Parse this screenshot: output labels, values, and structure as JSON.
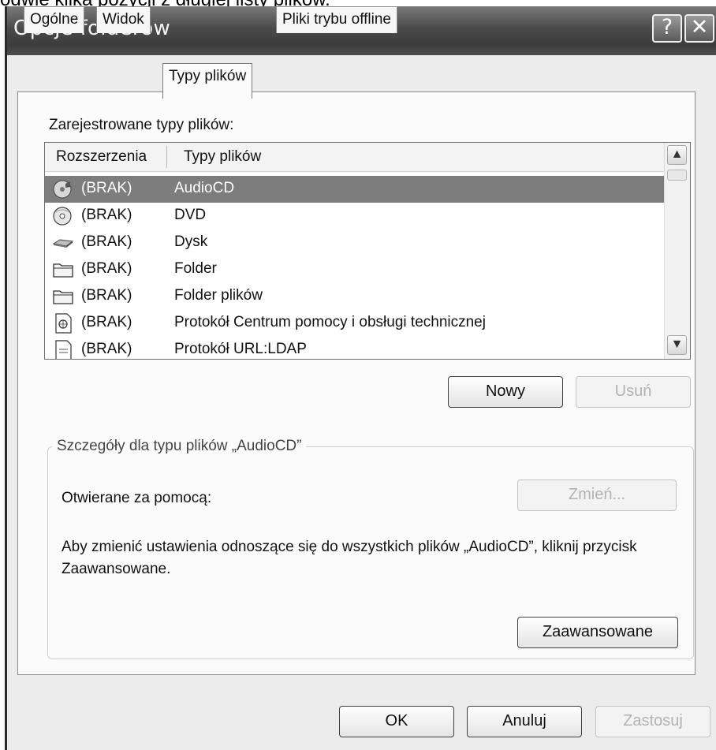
{
  "caption": "odwie klika pozycji z długiej listy plików.",
  "window": {
    "title": "Opcje folderów",
    "help_glyph": "?",
    "close_glyph": "✕"
  },
  "tabs": [
    {
      "label": "Ogólne",
      "active": false
    },
    {
      "label": "Widok",
      "active": false
    },
    {
      "label": "Typy plików",
      "active": true
    },
    {
      "label": "Pliki trybu offline",
      "active": false
    }
  ],
  "registered_label": "Zarejestrowane typy plików:",
  "list": {
    "columns": [
      "Rozszerzenia",
      "Typy plików"
    ],
    "rows": [
      {
        "icon": "audio-cd-icon",
        "ext": "(BRAK)",
        "type": "AudioCD",
        "selected": true
      },
      {
        "icon": "dvd-icon",
        "ext": "(BRAK)",
        "type": "DVD",
        "selected": false
      },
      {
        "icon": "drive-icon",
        "ext": "(BRAK)",
        "type": "Dysk",
        "selected": false
      },
      {
        "icon": "folder-icon",
        "ext": "(BRAK)",
        "type": "Folder",
        "selected": false
      },
      {
        "icon": "folder-icon",
        "ext": "(BRAK)",
        "type": "Folder plików",
        "selected": false
      },
      {
        "icon": "web-document-icon",
        "ext": "(BRAK)",
        "type": "Protokół Centrum pomocy i obsługi technicznej",
        "selected": false
      },
      {
        "icon": "document-icon",
        "ext": "(BRAK)",
        "type": "Protokół URL:LDAP",
        "selected": false
      }
    ],
    "scroll_up": "▲",
    "scroll_down": "▼"
  },
  "buttons": {
    "new": "Nowy",
    "delete": "Usuń",
    "change": "Zmień...",
    "advanced": "Zaawansowane",
    "ok": "OK",
    "cancel": "Anuluj",
    "apply": "Zastosuj"
  },
  "details": {
    "legend": "Szczegóły dla typu plików „AudioCD”",
    "opens_with": "Otwierane za pomocą:",
    "info": "Aby zmienić ustawienia odnoszące się do wszystkich plików „AudioCD”, kliknij przycisk Zaawansowane."
  }
}
